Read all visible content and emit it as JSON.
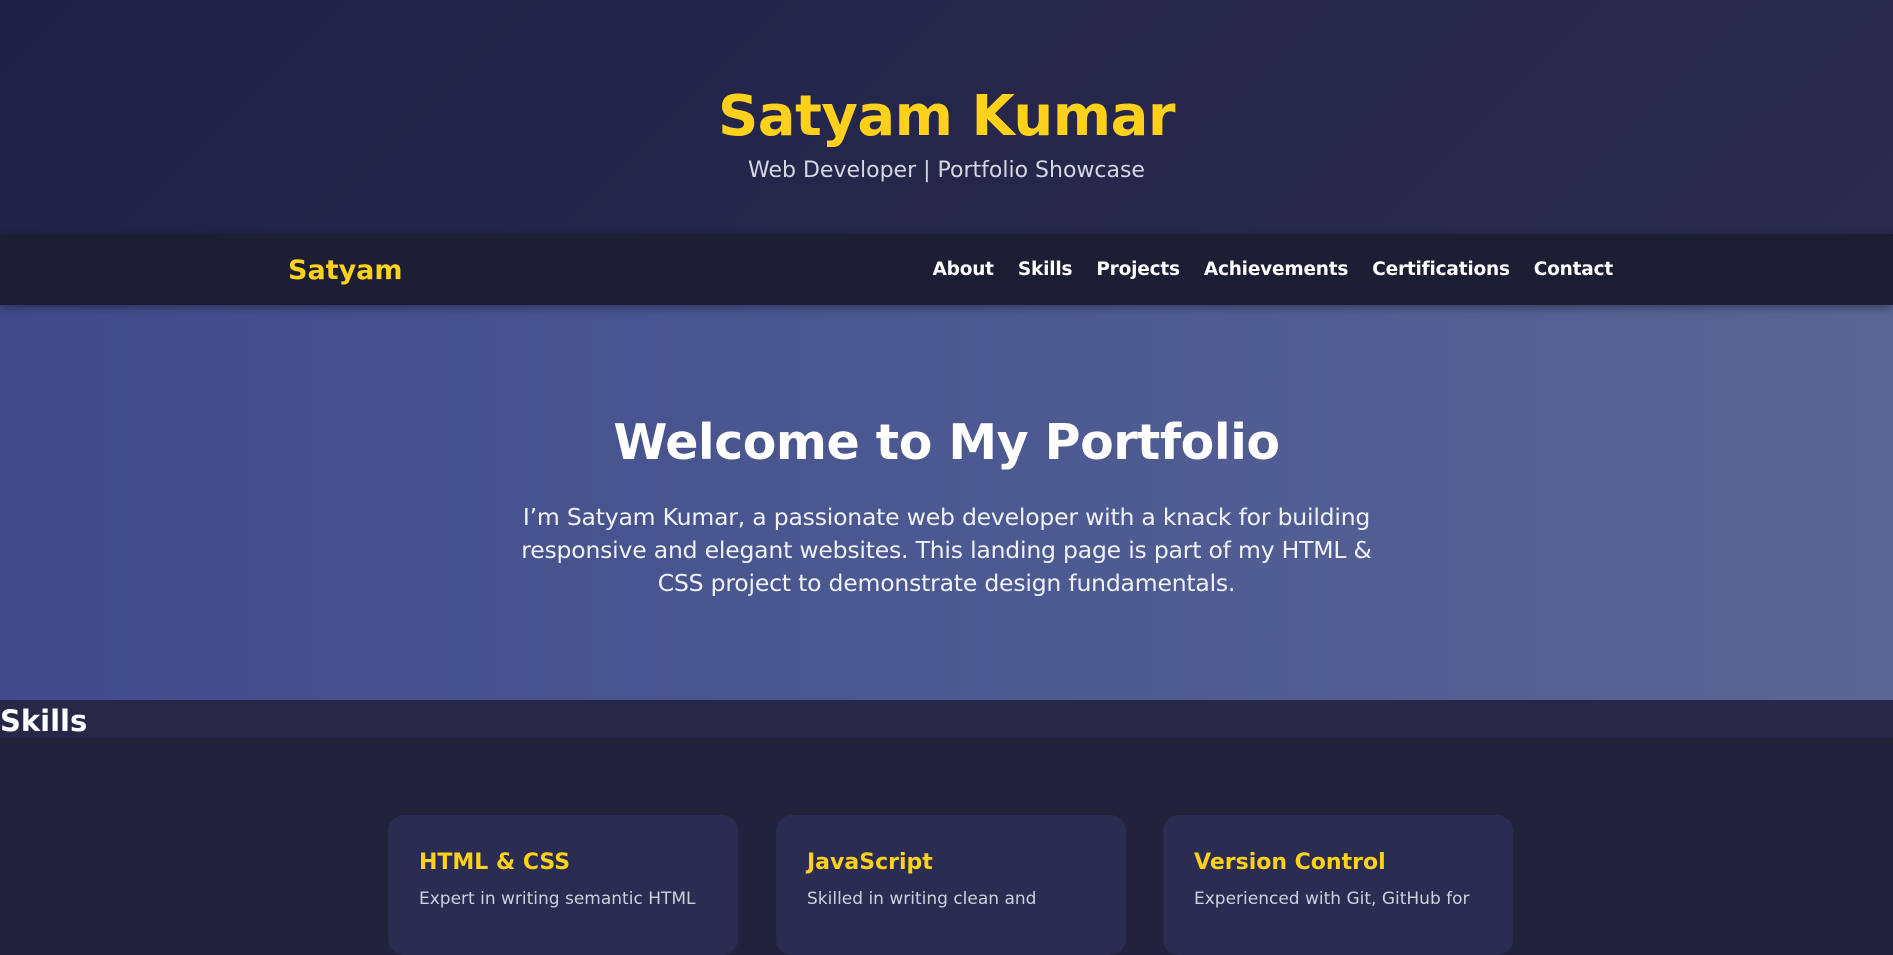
{
  "header": {
    "title": "Satyam Kumar",
    "subtitle": "Web Developer | Portfolio Showcase"
  },
  "navbar": {
    "brand": "Satyam",
    "links": [
      "About",
      "Skills",
      "Projects",
      "Achievements",
      "Certifications",
      "Contact"
    ]
  },
  "hero": {
    "title": "Welcome to My Portfolio",
    "text": "I’m Satyam Kumar, a passionate web developer with a knack for building responsive and elegant websites. This landing page is part of my HTML & CSS project to demonstrate design fundamentals."
  },
  "skills": {
    "heading": "Skills",
    "cards": [
      {
        "title": "HTML & CSS",
        "text": "Expert in writing semantic HTML"
      },
      {
        "title": "JavaScript",
        "text": "Skilled in writing clean and"
      },
      {
        "title": "Version Control",
        "text": "Experienced with Git, GitHub for"
      }
    ]
  },
  "colors": {
    "accent": "#ffd11a",
    "header_bg": "#1f2147",
    "nav_bg": "#1c1e33",
    "hero_bg_start": "#414b8a",
    "hero_bg_end": "#5a6595",
    "card_bg": "#2a2c52",
    "page_bg": "#22233b"
  }
}
